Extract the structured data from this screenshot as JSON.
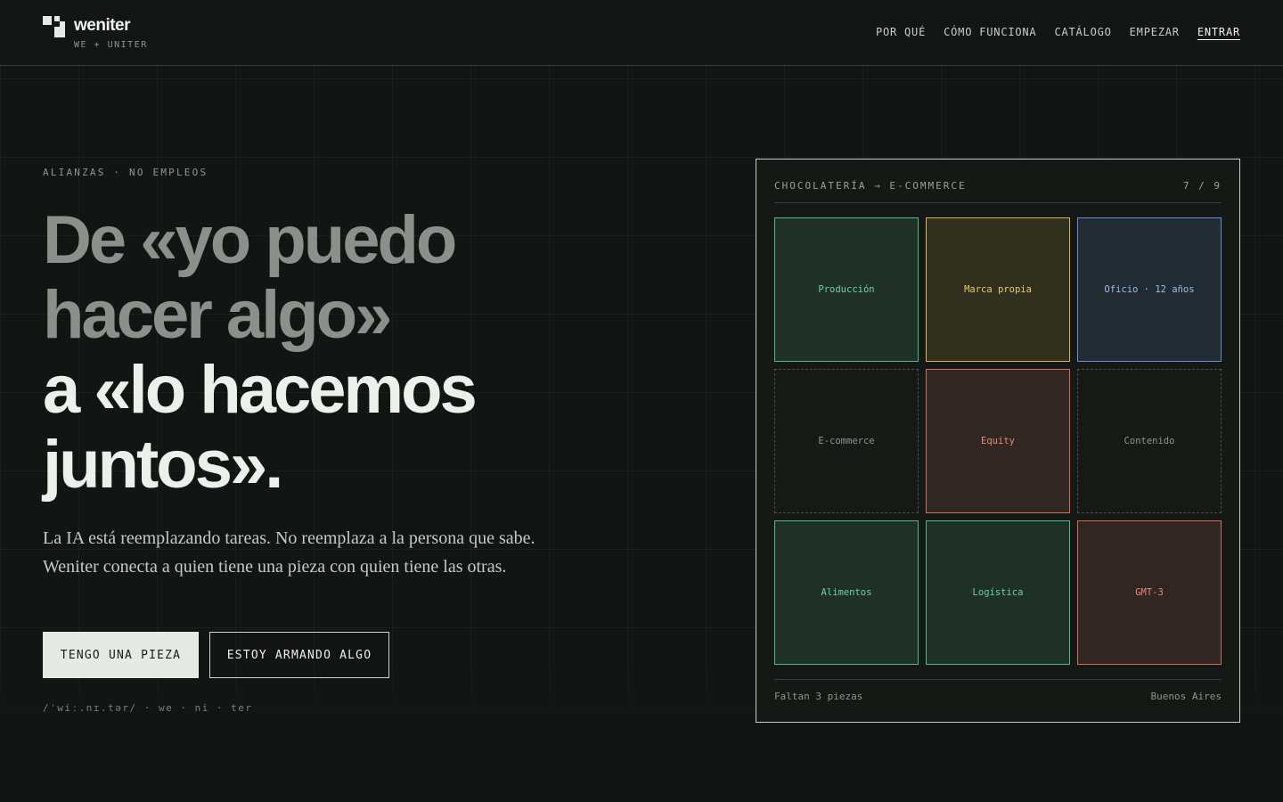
{
  "brand": {
    "name": "weniter",
    "tagline": "WE + UNITER"
  },
  "nav": [
    {
      "label": "POR QUÉ"
    },
    {
      "label": "CÓMO FUNCIONA"
    },
    {
      "label": "CATÁLOGO"
    },
    {
      "label": "EMPEZAR"
    },
    {
      "label": "ENTRAR",
      "active": true
    }
  ],
  "hero": {
    "eyebrow": "ALIANZAS · NO EMPLEOS",
    "headline_muted": [
      "De «yo puedo",
      "hacer algo»"
    ],
    "headline_bright": [
      "a «lo hacemos",
      "juntos»."
    ],
    "lead": "La IA está reemplazando tareas. No reemplaza a la persona que sabe. Weniter conecta a quien tiene una pieza con quien tiene las otras.",
    "primary_cta": "TENGO UNA PIEZA",
    "secondary_cta": "ESTOY ARMANDO ALGO",
    "phonetic": "/ˈwiː.nɪ.tər/ · we · ni · ter"
  },
  "panel": {
    "title": "CHOCOLATERÍA → E-COMMERCE",
    "count": "7 / 9",
    "pieces": [
      {
        "label": "Producción",
        "state": "filled",
        "color": "green"
      },
      {
        "label": "Marca propia",
        "state": "filled",
        "color": "yellow"
      },
      {
        "label": "Oficio · 12 años",
        "state": "filled",
        "color": "blue"
      },
      {
        "label": "E-commerce",
        "state": "missing"
      },
      {
        "label": "Equity",
        "state": "filled",
        "color": "red"
      },
      {
        "label": "Contenido",
        "state": "missing"
      },
      {
        "label": "Alimentos",
        "state": "filled",
        "color": "green"
      },
      {
        "label": "Logística",
        "state": "filled",
        "color": "green"
      },
      {
        "label": "GMT-3",
        "state": "filled",
        "color": "red"
      }
    ],
    "footer_left": "Faltan 3 piezas",
    "footer_right": "Buenos Aires"
  },
  "colors": {
    "background": "#131514",
    "green": "#4fb887",
    "yellow": "#d6b451",
    "blue": "#5f8ed4",
    "red": "#d46a5a"
  }
}
